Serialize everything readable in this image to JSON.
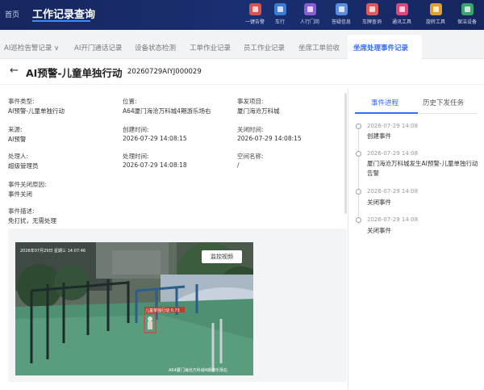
{
  "header": {
    "home": "首页",
    "title": "工作记录查询",
    "tools": [
      {
        "label": "一键告警",
        "color": "#d9534f"
      },
      {
        "label": "车行",
        "color": "#3a7bd5"
      },
      {
        "label": "人行门岗",
        "color": "#8e5bd6"
      },
      {
        "label": "答疑信息",
        "color": "#5a8de0"
      },
      {
        "label": "车牌查询",
        "color": "#e05a5a"
      },
      {
        "label": "通讯工具",
        "color": "#e0457a"
      },
      {
        "label": "旋转工具",
        "color": "#e0a030"
      },
      {
        "label": "保洁设备",
        "color": "#37a56e"
      }
    ]
  },
  "tabs": [
    {
      "label": "AI巡检告警记录 ∨"
    },
    {
      "label": "AI开门通话记录"
    },
    {
      "label": "设备状态检测"
    },
    {
      "label": "工单作业记录"
    },
    {
      "label": "员工作业记录"
    },
    {
      "label": "坐席工单验收"
    },
    {
      "label": "坐席处理事件记录"
    }
  ],
  "page": {
    "back": "←",
    "title": "AI预警-儿童单独行动",
    "event_id": "20260729AIYJ000029"
  },
  "fields": {
    "event_type": {
      "label": "事件类型:",
      "value": "AI预警-儿童单独行动"
    },
    "location": {
      "label": "位置:",
      "value": "A64厦门海沧万科城4期游乐场右"
    },
    "project": {
      "label": "事发项目:",
      "value": "厦门海沧万科城"
    },
    "source": {
      "label": "来源:",
      "value": "AI预警"
    },
    "created_time": {
      "label": "创建时间:",
      "value": "2026-07-29 14:08:15"
    },
    "closed_time": {
      "label": "关闭时间:",
      "value": "2026-07-29 14:08:15"
    },
    "handler": {
      "label": "处理人:",
      "value": "超级管理员"
    },
    "handled_time": {
      "label": "处理时间:",
      "value": "2026-07-29 14:08:18"
    },
    "space": {
      "label": "空间名称:",
      "value": "/"
    },
    "close_reason": {
      "label": "事件关闭原因:",
      "value": "事件关闭"
    },
    "description": {
      "label": "事件描述:",
      "value": "免打扰，无需处理"
    }
  },
  "video": {
    "button": "监控视频",
    "osd_time": "2026年07月29日 星期三 14:07:46",
    "detect_label": "儿童单独行动 0.73",
    "camera_label": "A64厦门海沧万科城4期游乐场右"
  },
  "right_panel": {
    "tabs": [
      {
        "label": "事件进程"
      },
      {
        "label": "历史下发任务"
      }
    ],
    "timeline": [
      {
        "time": "2026-07-29 14:08",
        "text": "创建事件"
      },
      {
        "time": "2026-07-29 14:08",
        "text": "厦门海沧万科城发生AI预警-儿童单独行动告警"
      },
      {
        "time": "2026-07-29 14:08",
        "text": "关闭事件"
      },
      {
        "time": "2026-07-29 14:08",
        "text": "关闭事件"
      }
    ]
  }
}
